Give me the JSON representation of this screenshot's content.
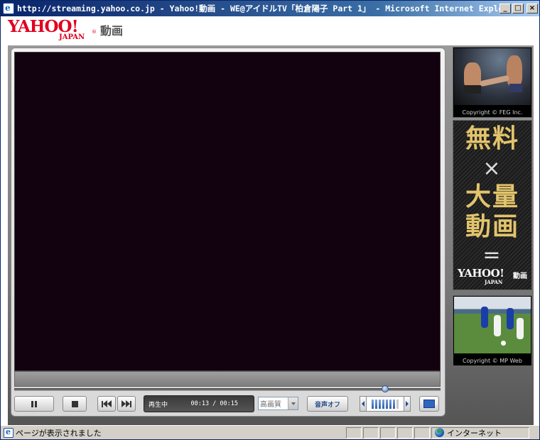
{
  "window": {
    "title": "http://streaming.yahoo.co.jp - Yahoo!動画 - WE@アイドルTV「柏倉陽子 Part 1」 - Microsoft Internet Explorer",
    "minimize": "_",
    "maximize": "□",
    "close": "×"
  },
  "logo": {
    "yahoo": "YAHOO!",
    "japan": "JAPAN",
    "registered": "®",
    "service": "動画"
  },
  "player": {
    "status": "再生中",
    "time": "00:13 / 00:15",
    "seek_fraction": 0.87,
    "quality": "高画質",
    "mute_label": "音声オフ",
    "volume_level": 7,
    "volume_max": 8
  },
  "ads": {
    "ad1_copyright": "Copyright © FEG Inc.",
    "ad2_line1": "無料",
    "ad2_line2": "×",
    "ad2_line3": "大量",
    "ad2_line4": "動画",
    "ad2_line5": "=",
    "ad2_logo": "YAHOO!",
    "ad2_logo_japan": "JAPAN",
    "ad2_logo_service": "動画",
    "ad3_copyright": "Copyright © MP Web"
  },
  "statusbar": {
    "message": "ページが表示されました",
    "zone": "インターネット"
  },
  "colors": {
    "titlebar": "#0a246a",
    "yahoo_red": "#e0001e",
    "video_bg": "#12010f",
    "ad_gold": "#e2c46b"
  }
}
